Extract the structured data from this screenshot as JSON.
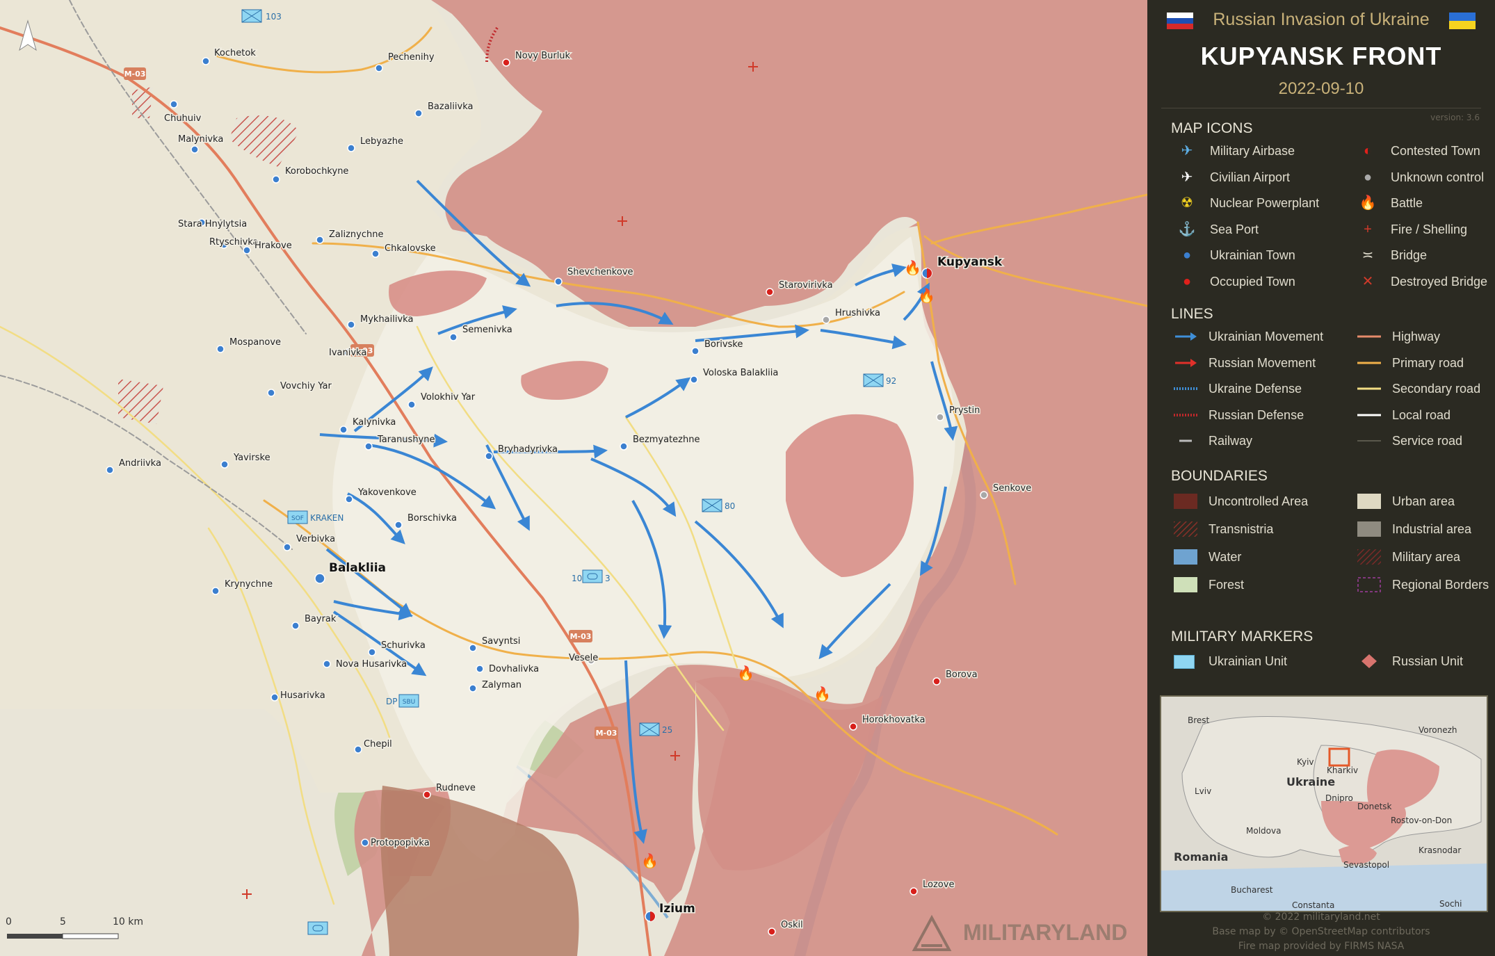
{
  "header": {
    "subtitle": "Russian Invasion of Ukraine",
    "title": "KUPYANSK FRONT",
    "date": "2022-09-10",
    "version": "version: 3.6"
  },
  "legend": {
    "map_icons_title": "MAP ICONS",
    "map_icons": [
      {
        "label": "Military Airbase",
        "icon": "military-airbase-icon"
      },
      {
        "label": "Civilian Airport",
        "icon": "civilian-airport-icon"
      },
      {
        "label": "Nuclear Powerplant",
        "icon": "nuclear-icon"
      },
      {
        "label": "Sea Port",
        "icon": "anchor-icon"
      },
      {
        "label": "Ukrainian Town",
        "icon": "blue-dot-icon"
      },
      {
        "label": "Occupied Town",
        "icon": "red-dot-icon"
      },
      {
        "label": "Contested Town",
        "icon": "half-dot-icon"
      },
      {
        "label": "Unknown control",
        "icon": "grey-dot-icon"
      },
      {
        "label": "Battle",
        "icon": "fire-icon"
      },
      {
        "label": "Fire / Shelling",
        "icon": "cross-icon"
      },
      {
        "label": "Bridge",
        "icon": "bridge-icon"
      },
      {
        "label": "Destroyed Bridge",
        "icon": "destroyed-bridge-icon"
      }
    ],
    "lines_title": "LINES",
    "lines": [
      {
        "label": "Ukrainian Movement",
        "color": "#3f8fd8"
      },
      {
        "label": "Russian Movement",
        "color": "#e0302a"
      },
      {
        "label": "Ukraine Defense",
        "color": "#3f8fd8"
      },
      {
        "label": "Russian Defense",
        "color": "#c0282b"
      },
      {
        "label": "Railway",
        "color": "#bbbbbb"
      },
      {
        "label": "Highway",
        "color": "#e68a6a"
      },
      {
        "label": "Primary road",
        "color": "#f0b04a"
      },
      {
        "label": "Secondary road",
        "color": "#f2dd84"
      },
      {
        "label": "Local road",
        "color": "#ffffff"
      },
      {
        "label": "Service road",
        "color": "#8a8676"
      }
    ],
    "boundaries_title": "BOUNDARIES",
    "boundaries": [
      {
        "label": "Uncontrolled Area",
        "color": "#6b2a22"
      },
      {
        "label": "Transnistria",
        "color": "#8a3028"
      },
      {
        "label": "Water",
        "color": "#6fa3d0"
      },
      {
        "label": "Forest",
        "color": "#cfe0b9"
      },
      {
        "label": "Urban area",
        "color": "#ded8c2"
      },
      {
        "label": "Industrial area",
        "color": "#8f8b80"
      },
      {
        "label": "Military area",
        "color": "#7a2a28"
      },
      {
        "label": "Regional Borders",
        "color": "#a03c9c"
      }
    ],
    "markers_title": "MILITARY MARKERS",
    "markers": [
      {
        "label": "Ukrainian Unit",
        "color": "#8fd6f2"
      },
      {
        "label": "Russian Unit",
        "color": "#d8746e"
      }
    ]
  },
  "inset": {
    "labels": [
      "Brest",
      "Voronezh",
      "Kyiv",
      "Lviv",
      "Ukraine",
      "Kharkiv",
      "Dnipro",
      "Donetsk",
      "Rostov-on-Don",
      "Moldova",
      "Romania",
      "Krasnodar",
      "Sevastopol",
      "Bucharest",
      "Constanta",
      "Sochi"
    ]
  },
  "credits": {
    "copyright": "© 2022 militaryland.net",
    "basemap": "Base map by © OpenStreetMap contributors",
    "firemap": "Fire map provided by FIRMS NASA"
  },
  "map": {
    "towns": [
      {
        "name": "Kupyansk",
        "status": "contested"
      },
      {
        "name": "Novy Burluk",
        "status": "occupied"
      },
      {
        "name": "Pechenihy",
        "status": "ukrainian"
      },
      {
        "name": "Kochetok",
        "status": "ukrainian"
      },
      {
        "name": "Chuhuiv",
        "status": "ukrainian"
      },
      {
        "name": "Malynivka",
        "status": "ukrainian"
      },
      {
        "name": "Bazaliivka",
        "status": "ukrainian"
      },
      {
        "name": "Lebyazhe",
        "status": "ukrainian"
      },
      {
        "name": "Korobochkyne",
        "status": "ukrainian"
      },
      {
        "name": "Stara Hnylytsia",
        "status": "ukrainian"
      },
      {
        "name": "Rtyschivka",
        "status": "ukrainian"
      },
      {
        "name": "Hrakove",
        "status": "ukrainian"
      },
      {
        "name": "Zaliznychne",
        "status": "ukrainian"
      },
      {
        "name": "Chkalovske",
        "status": "ukrainian"
      },
      {
        "name": "Shevchenkove",
        "status": "ukrainian"
      },
      {
        "name": "Starovirivka",
        "status": "occupied"
      },
      {
        "name": "Hrushivka",
        "status": "unknown"
      },
      {
        "name": "Mykhailivka",
        "status": "ukrainian"
      },
      {
        "name": "Semenivka",
        "status": "ukrainian"
      },
      {
        "name": "Borivske",
        "status": "ukrainian"
      },
      {
        "name": "Voloska Balakliia",
        "status": "ukrainian"
      },
      {
        "name": "Mospanove",
        "status": "ukrainian"
      },
      {
        "name": "Ivanivka",
        "status": "ukrainian"
      },
      {
        "name": "Vovchiy Yar",
        "status": "ukrainian"
      },
      {
        "name": "Volokhiv Yar",
        "status": "ukrainian"
      },
      {
        "name": "Kalynivka",
        "status": "ukrainian"
      },
      {
        "name": "Taranushyne",
        "status": "ukrainian"
      },
      {
        "name": "Prystin",
        "status": "unknown"
      },
      {
        "name": "Bryhadyrivka",
        "status": "ukrainian"
      },
      {
        "name": "Bezmyatezhne",
        "status": "ukrainian"
      },
      {
        "name": "Andriivka",
        "status": "ukrainian"
      },
      {
        "name": "Yavirske",
        "status": "ukrainian"
      },
      {
        "name": "Yakovenkove",
        "status": "ukrainian"
      },
      {
        "name": "Senkove",
        "status": "unknown"
      },
      {
        "name": "Borschivka",
        "status": "ukrainian"
      },
      {
        "name": "Verbivka",
        "status": "ukrainian"
      },
      {
        "name": "Balakliia",
        "status": "ukrainian"
      },
      {
        "name": "Krynychne",
        "status": "ukrainian"
      },
      {
        "name": "Bayrak",
        "status": "ukrainian"
      },
      {
        "name": "Schurivka",
        "status": "ukrainian"
      },
      {
        "name": "Savyntsi",
        "status": "ukrainian"
      },
      {
        "name": "Nova Husarivka",
        "status": "ukrainian"
      },
      {
        "name": "Dovhalivka",
        "status": "ukrainian"
      },
      {
        "name": "Vesele",
        "status": "unknown"
      },
      {
        "name": "Zalyman",
        "status": "ukrainian"
      },
      {
        "name": "Borova",
        "status": "occupied"
      },
      {
        "name": "Husarivka",
        "status": "ukrainian"
      },
      {
        "name": "Horokhovatka",
        "status": "occupied"
      },
      {
        "name": "Chepil",
        "status": "ukrainian"
      },
      {
        "name": "Rudneve",
        "status": "occupied"
      },
      {
        "name": "Protopopivka",
        "status": "ukrainian"
      },
      {
        "name": "Lozove",
        "status": "occupied"
      },
      {
        "name": "Izium",
        "status": "contested"
      },
      {
        "name": "Oskil",
        "status": "occupied"
      }
    ],
    "roads": [
      "M-03",
      "M-03",
      "M-03",
      "M-03"
    ],
    "units": [
      "103",
      "92",
      "80",
      "SOF",
      "KRAKEN",
      "10",
      "3",
      "DP",
      "SBU",
      "25"
    ],
    "scale": {
      "zero": "0",
      "five": "5",
      "ten": "10 km"
    },
    "watermark": "MILITARYLAND"
  }
}
